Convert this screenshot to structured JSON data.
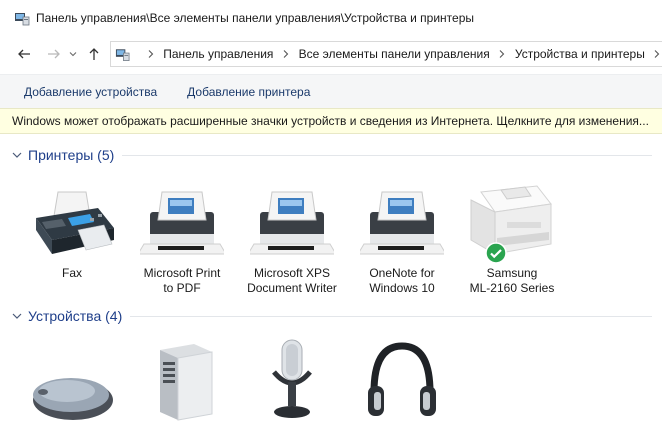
{
  "window": {
    "title": "Панель управления\\Все элементы панели управления\\Устройства и принтеры"
  },
  "breadcrumb": {
    "items": [
      "Панель управления",
      "Все элементы панели управления",
      "Устройства и принтеры"
    ]
  },
  "toolbar": {
    "add_device": "Добавление устройства",
    "add_printer": "Добавление принтера"
  },
  "infobar": {
    "text": "Windows может отображать расширенные значки устройств и сведения из Интернета.  Щелкните для изменения..."
  },
  "groups": {
    "printers": {
      "title": "Принтеры (5)",
      "items": [
        {
          "label": "Fax",
          "icon": "fax-icon"
        },
        {
          "label": "Microsoft Print\nto PDF",
          "icon": "printer-icon"
        },
        {
          "label": "Microsoft XPS\nDocument Writer",
          "icon": "printer-icon"
        },
        {
          "label": "OneNote for\nWindows 10",
          "icon": "printer-icon"
        },
        {
          "label": "Samsung\nML-2160 Series",
          "icon": "laser-printer-icon",
          "status": "default-printer"
        }
      ]
    },
    "devices": {
      "title": "Устройства (4)",
      "items": [
        {
          "icon": "mouse-icon"
        },
        {
          "icon": "computer-tower-icon"
        },
        {
          "icon": "microphone-icon"
        },
        {
          "icon": "headphones-icon"
        }
      ]
    }
  },
  "colors": {
    "group_title": "#1f3f8a",
    "infobar_bg": "#ffffe1",
    "default_check": "#2aa44f"
  }
}
